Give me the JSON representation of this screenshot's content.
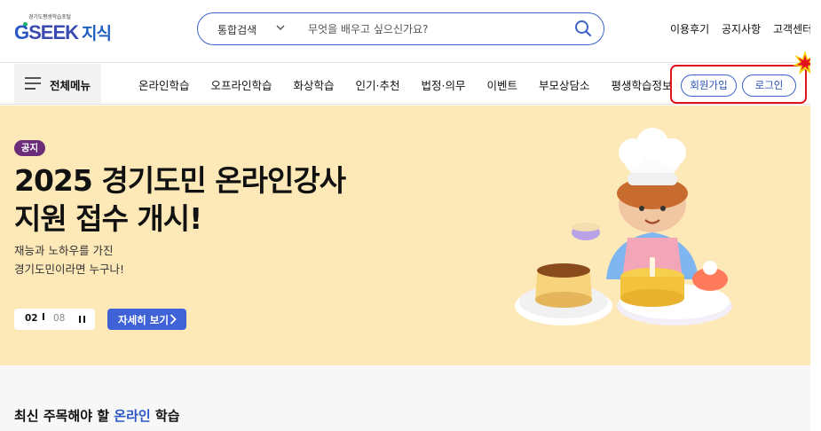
{
  "logo": {
    "tagline": "경기도평생학습포털",
    "brand_g": "G",
    "brand_seek": "SEEK",
    "brand_jisik": "지식"
  },
  "search": {
    "category": "통합검색",
    "placeholder": "무엇을 배우고 싶으신가요?",
    "value": ""
  },
  "top_links": [
    "이용후기",
    "공지사항",
    "고객센터"
  ],
  "nav": {
    "all_menu_label": "전체메뉴",
    "items": [
      "온라인학습",
      "오프라인학습",
      "화상학습",
      "인기·추천",
      "법정·의무",
      "이벤트",
      "부모상담소",
      "평생학습정보"
    ],
    "signup_label": "회원가입",
    "login_label": "로그인"
  },
  "hero": {
    "badge": "공지",
    "title_line1": "2025 경기도민 온라인강사",
    "title_line2": "지원 접수 개시!",
    "sub_line1": "재능과 노하우를 가진",
    "sub_line2": "경기도민이라면 누구나!",
    "pager_current": "02",
    "pager_separator": "I",
    "pager_total": "08",
    "more_label": "자세히 보기"
  },
  "section": {
    "title_pre": "최신 주목해야 할 ",
    "title_accent": "온라인",
    "title_post": " 학습"
  },
  "colors": {
    "primary": "#3f63c8",
    "hero_bg": "#fde8b8",
    "badge": "#6b2d7a",
    "highlight": "#e0141e",
    "button": "#3f63d6"
  }
}
